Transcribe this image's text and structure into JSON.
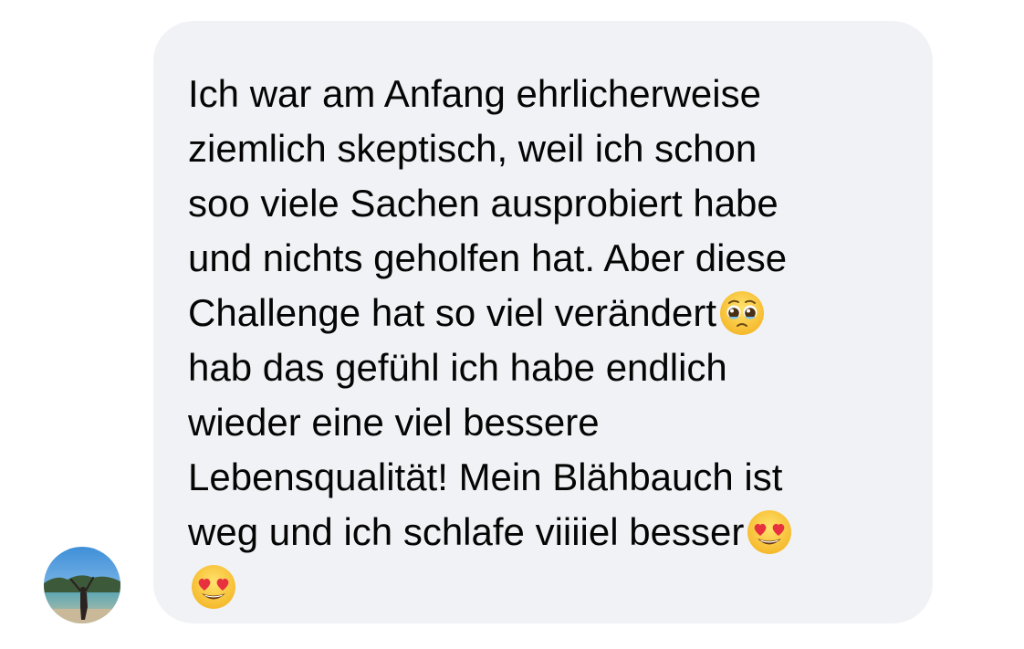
{
  "conversation": {
    "message": {
      "text_parts": [
        "Ich war am Anfang ehrlicherweise\nziemlich skeptisch, weil ich schon\nsoo viele Sachen ausprobiert habe\nund nichts geholfen hat. Aber diese\nChallenge hat so viel verändert",
        "\nhab das gefühl ich habe endlich\nwieder eine viel bessere\nLebensqualität! Mein Blähbauch ist\nweg und ich schlafe viiiiel besser",
        "\n"
      ],
      "emojis": [
        "pleading-face-emoji",
        "heart-eyes-emoji",
        "heart-eyes-emoji"
      ]
    },
    "sender": {
      "avatar_icon": "profile-photo-beach"
    }
  },
  "colors": {
    "bubble_background": "#f1f2f5",
    "text": "#050505",
    "page_background": "#ffffff"
  }
}
